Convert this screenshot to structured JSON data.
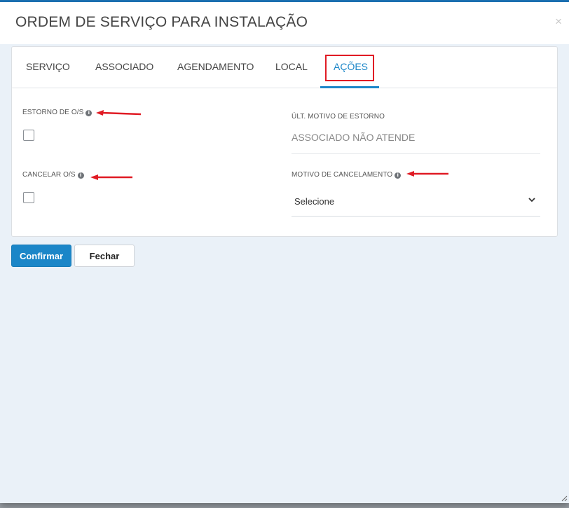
{
  "modal": {
    "title": "ORDEM DE SERVIÇO PARA INSTALAÇÃO",
    "close_symbol": "×"
  },
  "tabs": [
    {
      "label": "SERVIÇO",
      "active": false
    },
    {
      "label": "ASSOCIADO",
      "active": false
    },
    {
      "label": "AGENDAMENTO",
      "active": false
    },
    {
      "label": "LOCAL",
      "active": false
    },
    {
      "label": "AÇÕES",
      "active": true
    }
  ],
  "form": {
    "estorno_label": "ESTORNO DE O/S",
    "estorno_checked": false,
    "cancelar_label": "CANCELAR O/S",
    "cancelar_checked": false,
    "ult_motivo_label": "ÚLT. MOTIVO DE ESTORNO",
    "ult_motivo_value": "ASSOCIADO NÃO ATENDE",
    "motivo_cancelamento_label": "MOTIVO DE CANCELAMENTO",
    "motivo_cancelamento_selected": "Selecione"
  },
  "buttons": {
    "confirm": "Confirmar",
    "close": "Fechar"
  },
  "icons": {
    "info": "info-icon",
    "chevron": "chevron-down-icon",
    "annotation": "red-arrow-icon"
  },
  "colors": {
    "accent": "#1b86c8",
    "annotation_red": "#e01b24",
    "background": "#eaf1f8"
  }
}
